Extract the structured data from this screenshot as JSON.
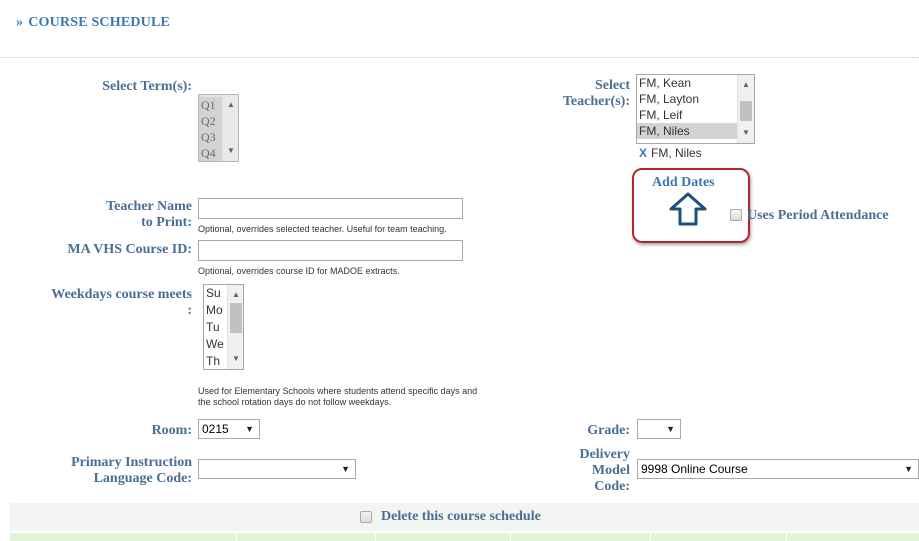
{
  "header": {
    "title": "COURSE SCHEDULE",
    "chevron": "»"
  },
  "terms": {
    "label": "Select Term(s):",
    "options": [
      "Q1",
      "Q2",
      "Q3",
      "Q4"
    ]
  },
  "teachers": {
    "label_line1": "Select",
    "label_line2": "Teacher(s):",
    "options": [
      "FM, Kean",
      "FM, Layton",
      "FM, Leif",
      "FM, Niles"
    ],
    "selected_index": 3,
    "selected_x": "X",
    "selected_name": "FM, Niles"
  },
  "add_dates": {
    "label": "Add Dates",
    "icon": "arrow-up-icon"
  },
  "uses_period_attendance": {
    "label": "Uses Period Attendance",
    "checked": false
  },
  "teacher_name": {
    "label_line1": "Teacher Name",
    "label_line2": "to Print:",
    "value": "",
    "hint": "Optional, overrides selected teacher. Useful for team teaching."
  },
  "course_id": {
    "label": "MA VHS Course ID:",
    "value": "",
    "hint": "Optional, overrides course ID for MADOE extracts."
  },
  "weekdays": {
    "label_line1": "Weekdays course meets",
    "label_line2": ":",
    "options": [
      "Su",
      "Mo",
      "Tu",
      "We",
      "Th"
    ],
    "hint_line1": "Used for Elementary Schools where students attend specific days and",
    "hint_line2": "the school rotation days do not follow weekdays."
  },
  "room": {
    "label": "Room:",
    "value": "0215"
  },
  "grade": {
    "label": "Grade:",
    "value": ""
  },
  "language": {
    "label_line1": "Primary Instruction",
    "label_line2": "Language Code:",
    "value": ""
  },
  "delivery": {
    "label_line1": "Delivery",
    "label_line2": "Model",
    "label_line3": "Code:",
    "value": "9998 Online Course"
  },
  "delete_schedule": {
    "label": "Delete this course schedule",
    "checked": false
  },
  "colors": {
    "accent": "#3a78b0",
    "label": "#4a6e94",
    "highlight_border": "#b3262e"
  }
}
